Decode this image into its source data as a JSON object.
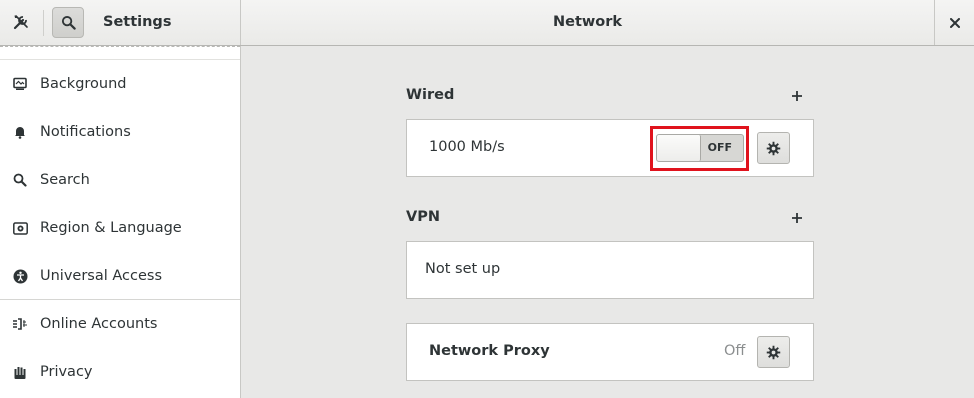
{
  "header": {
    "left_title": "Settings",
    "title": "Network",
    "tools_icon": "tools-icon",
    "search_icon": "search-icon",
    "close_icon": "close-icon"
  },
  "sidebar": {
    "items": [
      {
        "label": "Background",
        "icon": "background-icon"
      },
      {
        "label": "Notifications",
        "icon": "bell-icon"
      },
      {
        "label": "Search",
        "icon": "search-icon"
      },
      {
        "label": "Region & Language",
        "icon": "region-language-icon"
      },
      {
        "label": "Universal Access",
        "icon": "universal-access-icon"
      },
      {
        "label": "Online Accounts",
        "icon": "online-accounts-icon"
      },
      {
        "label": "Privacy",
        "icon": "privacy-hand-icon"
      }
    ]
  },
  "network": {
    "wired": {
      "title": "Wired",
      "connection_label": "1000 Mb/s",
      "switch_state": "OFF",
      "add_icon": "plus-icon",
      "settings_icon": "gear-icon"
    },
    "vpn": {
      "title": "VPN",
      "status": "Not set up",
      "add_icon": "plus-icon"
    },
    "proxy": {
      "label": "Network Proxy",
      "status": "Off",
      "settings_icon": "gear-icon"
    }
  },
  "colors": {
    "highlight": "#e0131d",
    "background": "#e8e8e7",
    "card": "#ffffff",
    "text": "#2e3436",
    "muted_text": "#8b8e8f"
  }
}
